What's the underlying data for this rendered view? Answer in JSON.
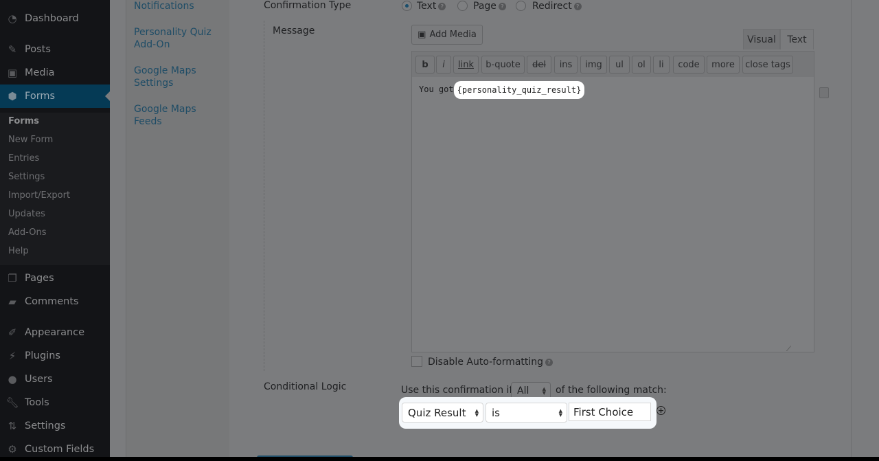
{
  "sidebar": {
    "items": [
      {
        "label": "Dashboard",
        "icon": "dashboard-icon"
      },
      {
        "label": "Posts",
        "icon": "pin-icon"
      },
      {
        "label": "Media",
        "icon": "media-icon"
      },
      {
        "label": "Forms",
        "icon": "forms-icon",
        "active": true
      },
      {
        "label": "Pages",
        "icon": "pages-icon"
      },
      {
        "label": "Comments",
        "icon": "comment-icon"
      },
      {
        "label": "Appearance",
        "icon": "brush-icon"
      },
      {
        "label": "Plugins",
        "icon": "plugin-icon"
      },
      {
        "label": "Users",
        "icon": "user-icon"
      },
      {
        "label": "Tools",
        "icon": "wrench-icon"
      },
      {
        "label": "Settings",
        "icon": "settings-icon"
      },
      {
        "label": "Custom Fields",
        "icon": "gear-icon"
      }
    ],
    "submenu": [
      "Forms",
      "New Form",
      "Entries",
      "Settings",
      "Import/Export",
      "Updates",
      "Add-Ons",
      "Help"
    ]
  },
  "subnav": [
    "Notifications",
    "Personality Quiz Add-On",
    "Google Maps Settings",
    "Google Maps Feeds"
  ],
  "confirmation": {
    "type_label": "Confirmation Type",
    "options": [
      "Text",
      "Page",
      "Redirect"
    ],
    "selected": "Text",
    "message_label": "Message",
    "add_media": "Add Media",
    "editor_tabs": [
      "Visual",
      "Text"
    ],
    "quicktags": [
      "b",
      "i",
      "link",
      "b-quote",
      "del",
      "ins",
      "img",
      "ul",
      "ol",
      "li",
      "code",
      "more",
      "close tags"
    ],
    "content_prefix": "You got",
    "merge_tag": "{personality_quiz_result}",
    "disable_autoformat": "Disable Auto-formatting"
  },
  "conditional": {
    "label": "Conditional Logic",
    "prefix": "Use this confirmation if",
    "match": "All",
    "suffix": "of the following match:",
    "field": "Quiz Result",
    "operator": "is",
    "value": "First Choice"
  }
}
